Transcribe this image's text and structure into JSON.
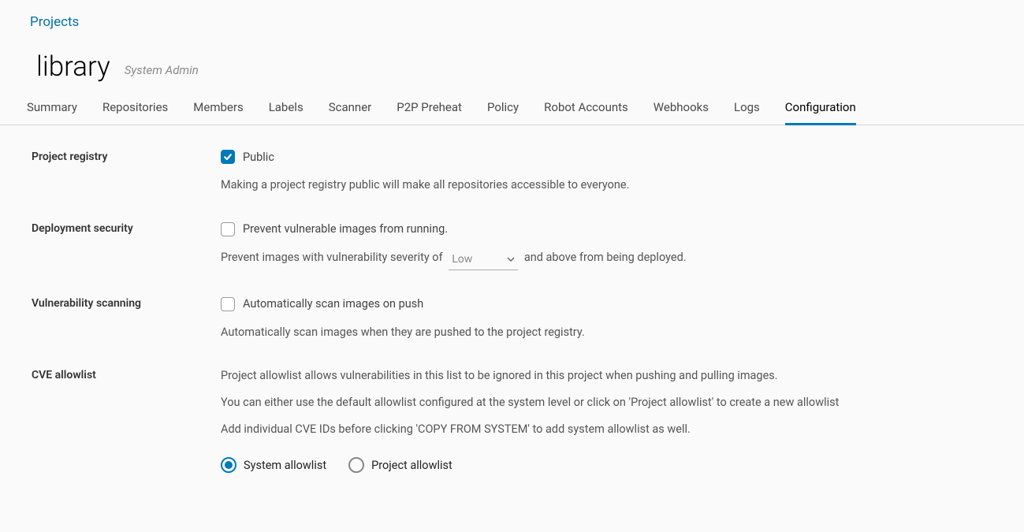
{
  "breadcrumb": {
    "projects": "Projects"
  },
  "title": {
    "name": "library",
    "role": "System Admin"
  },
  "tabs": [
    {
      "label": "Summary",
      "active": false
    },
    {
      "label": "Repositories",
      "active": false
    },
    {
      "label": "Members",
      "active": false
    },
    {
      "label": "Labels",
      "active": false
    },
    {
      "label": "Scanner",
      "active": false
    },
    {
      "label": "P2P Preheat",
      "active": false
    },
    {
      "label": "Policy",
      "active": false
    },
    {
      "label": "Robot Accounts",
      "active": false
    },
    {
      "label": "Webhooks",
      "active": false
    },
    {
      "label": "Logs",
      "active": false
    },
    {
      "label": "Configuration",
      "active": true
    }
  ],
  "config": {
    "registry": {
      "label": "Project registry",
      "checkbox_label": "Public",
      "checked": true,
      "desc": "Making a project registry public will make all repositories accessible to everyone."
    },
    "deployment": {
      "label": "Deployment security",
      "checkbox_label": "Prevent vulnerable images from running.",
      "checked": false,
      "desc_prefix": "Prevent images with vulnerability severity of",
      "severity": "Low",
      "desc_suffix": "and above from being deployed."
    },
    "scanning": {
      "label": "Vulnerability scanning",
      "checkbox_label": "Automatically scan images on push",
      "checked": false,
      "desc": "Automatically scan images when they are pushed to the project registry."
    },
    "cve": {
      "label": "CVE allowlist",
      "desc1": "Project allowlist allows vulnerabilities in this list to be ignored in this project when pushing and pulling images.",
      "desc2": "You can either use the default allowlist configured at the system level or click on 'Project allowlist' to create a new allowlist",
      "desc3": "Add individual CVE IDs before clicking 'COPY FROM SYSTEM' to add system allowlist as well.",
      "radio_system": "System allowlist",
      "radio_project": "Project allowlist",
      "selected": "system"
    }
  }
}
